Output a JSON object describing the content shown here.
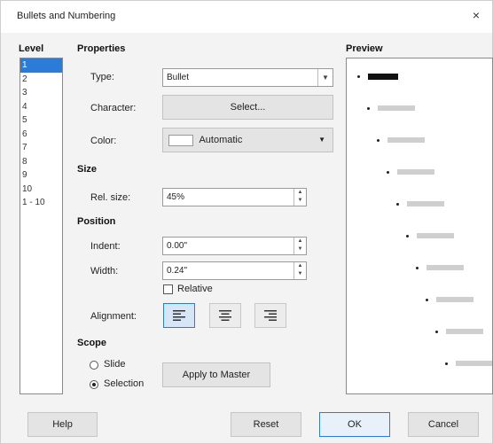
{
  "window": {
    "title": "Bullets and Numbering",
    "close_glyph": "×"
  },
  "level": {
    "header": "Level",
    "items": [
      "1",
      "2",
      "3",
      "4",
      "5",
      "6",
      "7",
      "8",
      "9",
      "10",
      "1 - 10"
    ],
    "selected_index": 0
  },
  "properties": {
    "header": "Properties",
    "type_label": "Type:",
    "type_value": "Bullet",
    "character_label": "Character:",
    "select_button": "Select...",
    "color_label": "Color:",
    "color_value": "Automatic",
    "color_swatch": "#ffffff"
  },
  "size": {
    "header": "Size",
    "rel_size_label": "Rel. size:",
    "rel_size_value": "45%"
  },
  "position": {
    "header": "Position",
    "indent_label": "Indent:",
    "indent_value": "0.00\"",
    "width_label": "Width:",
    "width_value": "0.24\"",
    "relative_label": "Relative",
    "relative_checked": false,
    "alignment_label": "Alignment:",
    "alignment_selected": "left"
  },
  "scope": {
    "header": "Scope",
    "slide_label": "Slide",
    "selection_label": "Selection",
    "selected": "selection",
    "apply_button": "Apply to Master"
  },
  "preview": {
    "header": "Preview"
  },
  "footer": {
    "help": "Help",
    "reset": "Reset",
    "ok": "OK",
    "cancel": "Cancel"
  },
  "colors": {
    "accent": "#2c7bd6",
    "dialog_bg": "#f3f3f3",
    "preview_bar": "#cfcfcf"
  }
}
